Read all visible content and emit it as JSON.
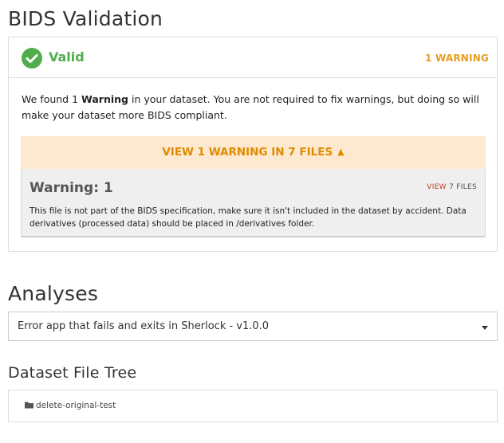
{
  "bids": {
    "title": "BIDS Validation",
    "status": "Valid",
    "warning_count": "1 WARNING",
    "message_pre": "We found 1 ",
    "message_bold": "Warning",
    "message_post": " in your dataset. You are not required to fix warnings, but doing so will make your dataset more BIDS compliant.",
    "view_warnings_label": "VIEW 1 WARNING IN 7 FILES",
    "warning": {
      "title": "Warning: 1",
      "view_word": "VIEW",
      "files_count": "7 FILES",
      "text": "This file is not part of the BIDS specification, make sure it isn't included in the dataset by accident. Data derivatives (processed data) should be placed in /derivatives folder."
    },
    "colors": {
      "valid": "#4fae4b",
      "warning": "#e89c1f",
      "warning_bg": "#fde9cf"
    }
  },
  "analyses": {
    "title": "Analyses",
    "selected_app": "Error app that fails and exits in Sherlock - v1.0.0"
  },
  "file_tree": {
    "title": "Dataset File Tree",
    "root_folder": "delete-original-test",
    "icon": "folder-icon"
  }
}
